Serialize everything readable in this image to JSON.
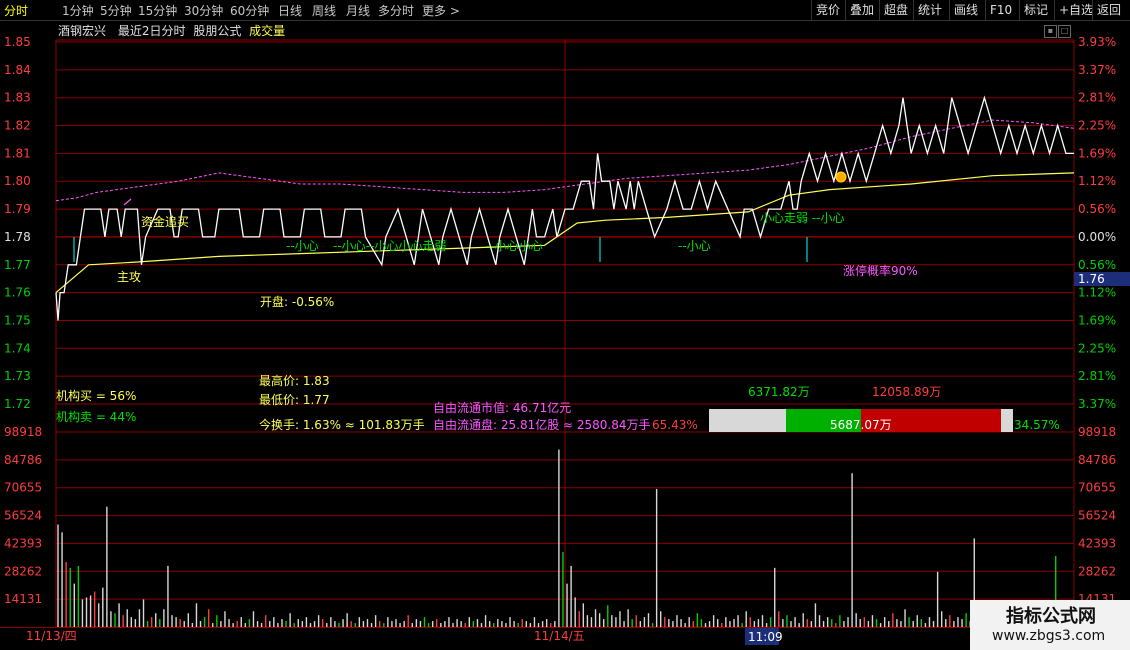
{
  "toolbar": {
    "periods": [
      "分时",
      "1分钟",
      "5分钟",
      "15分钟",
      "30分钟",
      "60分钟",
      "日线",
      "周线",
      "月线",
      "多分时",
      "更多 >"
    ],
    "active_index": 0,
    "right": [
      "竞价",
      "叠加",
      "超盘",
      "统计",
      "画线",
      "F10",
      "标记",
      "+自选",
      "返回"
    ]
  },
  "header": {
    "stock": "酒钢宏兴",
    "mode": "最近2日分时",
    "formula": "股朋公式",
    "indicator": "成交量"
  },
  "colors": {
    "up": "#ff3c3c",
    "down": "#00d000",
    "price": "#ffffff",
    "avg": "#ffff55",
    "mag": "#ff55ff",
    "cyan": "#00ffff",
    "grid": "#8b0000"
  },
  "price_axis": {
    "left": [
      "1.85",
      "1.84",
      "1.83",
      "1.82",
      "1.81",
      "1.80",
      "1.79",
      "1.78",
      "1.77",
      "1.76",
      "1.75",
      "1.74",
      "1.73",
      "1.72"
    ],
    "right": [
      "3.93%",
      "3.37%",
      "2.81%",
      "2.25%",
      "1.69%",
      "1.12%",
      "0.56%",
      "0.00%",
      "0.56%",
      "1.12%",
      "1.69%",
      "2.25%",
      "2.81%",
      "3.37%"
    ],
    "current_tag": "1.76"
  },
  "volume_axis": [
    "98918",
    "84786",
    "70655",
    "56524",
    "42393",
    "28262",
    "14131"
  ],
  "time_axis": {
    "labels": [
      "11/13/四",
      "11/14/五"
    ],
    "cursor": "11:09"
  },
  "annotations": {
    "zhugong": "主攻",
    "zijin": "资金追买",
    "xiaoxin": [
      "--小心",
      "--小心--小心小心走弱",
      "--小心小心",
      "--小心",
      "小心走弱 --小心"
    ],
    "zhangting": "涨停概率90%"
  },
  "info": {
    "open": "开盘: -0.56%",
    "inst_buy": "机构买 = 56%",
    "inst_sell": "机构卖 = 44%",
    "high": "最高价: 1.83",
    "low": "最低价: 1.77",
    "turnover": "今换手: 1.63% ≈ 101.83万手",
    "free_mv": "自由流通市值: 46.71亿元",
    "free_float": "自由流通盘: 25.81亿股 ≈ 2580.84万手",
    "free_pct": "65.43%",
    "flow_green": "6371.82万",
    "flow_red": "12058.89万",
    "flow_mid": "5687.07万",
    "flow_pct": "34.57%"
  },
  "watermark": {
    "title": "指标公式网",
    "url": "www.zbgs3.com"
  },
  "chart_data": {
    "type": "line",
    "y_range": [
      1.72,
      1.85
    ],
    "prev_close": 1.78,
    "volume_range": [
      0,
      98918
    ],
    "price_path": [
      [
        0,
        1.76
      ],
      [
        1,
        1.75
      ],
      [
        2,
        1.76
      ],
      [
        4,
        1.76
      ],
      [
        6,
        1.77
      ],
      [
        10,
        1.77
      ],
      [
        12,
        1.78
      ],
      [
        14,
        1.79
      ],
      [
        22,
        1.79
      ],
      [
        24,
        1.78
      ],
      [
        26,
        1.79
      ],
      [
        30,
        1.79
      ],
      [
        32,
        1.78
      ],
      [
        34,
        1.79
      ],
      [
        40,
        1.79
      ],
      [
        42,
        1.77
      ],
      [
        44,
        1.78
      ],
      [
        50,
        1.79
      ],
      [
        56,
        1.79
      ],
      [
        58,
        1.78
      ],
      [
        60,
        1.78
      ],
      [
        62,
        1.79
      ],
      [
        70,
        1.79
      ],
      [
        72,
        1.78
      ],
      [
        78,
        1.78
      ],
      [
        80,
        1.79
      ],
      [
        90,
        1.79
      ],
      [
        92,
        1.78
      ],
      [
        100,
        1.78
      ],
      [
        102,
        1.79
      ],
      [
        110,
        1.79
      ],
      [
        112,
        1.78
      ],
      [
        120,
        1.78
      ],
      [
        122,
        1.79
      ],
      [
        130,
        1.79
      ],
      [
        132,
        1.78
      ],
      [
        140,
        1.78
      ],
      [
        142,
        1.79
      ],
      [
        150,
        1.79
      ],
      [
        152,
        1.78
      ],
      [
        160,
        1.77
      ],
      [
        162,
        1.78
      ],
      [
        168,
        1.79
      ],
      [
        172,
        1.78
      ],
      [
        176,
        1.77
      ],
      [
        178,
        1.78
      ],
      [
        180,
        1.79
      ],
      [
        184,
        1.78
      ],
      [
        188,
        1.77
      ],
      [
        190,
        1.78
      ],
      [
        194,
        1.79
      ],
      [
        198,
        1.78
      ],
      [
        202,
        1.77
      ],
      [
        204,
        1.78
      ],
      [
        208,
        1.79
      ],
      [
        212,
        1.78
      ],
      [
        216,
        1.77
      ],
      [
        218,
        1.78
      ],
      [
        222,
        1.79
      ],
      [
        226,
        1.78
      ],
      [
        230,
        1.77
      ],
      [
        232,
        1.78
      ],
      [
        234,
        1.79
      ],
      [
        236,
        1.78
      ],
      [
        240,
        1.78
      ],
      [
        244,
        1.79
      ],
      [
        246,
        1.78
      ],
      [
        250,
        1.79
      ],
      [
        254,
        1.79
      ],
      [
        258,
        1.8
      ],
      [
        262,
        1.8
      ],
      [
        264,
        1.79
      ],
      [
        266,
        1.81
      ],
      [
        268,
        1.8
      ],
      [
        272,
        1.8
      ],
      [
        274,
        1.79
      ],
      [
        276,
        1.8
      ],
      [
        280,
        1.79
      ],
      [
        282,
        1.8
      ],
      [
        284,
        1.79
      ],
      [
        286,
        1.8
      ],
      [
        290,
        1.79
      ],
      [
        294,
        1.78
      ],
      [
        300,
        1.79
      ],
      [
        304,
        1.8
      ],
      [
        308,
        1.79
      ],
      [
        312,
        1.79
      ],
      [
        316,
        1.8
      ],
      [
        320,
        1.79
      ],
      [
        324,
        1.8
      ],
      [
        330,
        1.79
      ],
      [
        336,
        1.78
      ],
      [
        338,
        1.79
      ],
      [
        342,
        1.79
      ],
      [
        346,
        1.78
      ],
      [
        350,
        1.79
      ],
      [
        356,
        1.79
      ],
      [
        360,
        1.8
      ],
      [
        362,
        1.79
      ],
      [
        364,
        1.79
      ],
      [
        366,
        1.8
      ],
      [
        370,
        1.81
      ],
      [
        374,
        1.8
      ],
      [
        378,
        1.81
      ],
      [
        382,
        1.8
      ],
      [
        386,
        1.81
      ],
      [
        390,
        1.8
      ],
      [
        394,
        1.81
      ],
      [
        398,
        1.8
      ],
      [
        402,
        1.81
      ],
      [
        406,
        1.82
      ],
      [
        410,
        1.81
      ],
      [
        414,
        1.82
      ],
      [
        416,
        1.83
      ],
      [
        418,
        1.82
      ],
      [
        420,
        1.81
      ],
      [
        424,
        1.82
      ],
      [
        428,
        1.81
      ],
      [
        432,
        1.82
      ],
      [
        436,
        1.81
      ],
      [
        440,
        1.83
      ],
      [
        444,
        1.82
      ],
      [
        448,
        1.81
      ],
      [
        452,
        1.82
      ],
      [
        456,
        1.83
      ],
      [
        460,
        1.82
      ],
      [
        464,
        1.81
      ],
      [
        468,
        1.82
      ],
      [
        472,
        1.81
      ],
      [
        476,
        1.82
      ],
      [
        480,
        1.81
      ],
      [
        484,
        1.82
      ],
      [
        488,
        1.81
      ],
      [
        492,
        1.82
      ],
      [
        496,
        1.81
      ],
      [
        500,
        1.81
      ]
    ],
    "avg_path": [
      [
        0,
        1.76
      ],
      [
        8,
        1.765
      ],
      [
        16,
        1.77
      ],
      [
        40,
        1.771
      ],
      [
        80,
        1.773
      ],
      [
        120,
        1.774
      ],
      [
        160,
        1.775
      ],
      [
        200,
        1.776
      ],
      [
        240,
        1.777
      ],
      [
        256,
        1.785
      ],
      [
        270,
        1.786
      ],
      [
        300,
        1.787
      ],
      [
        340,
        1.789
      ],
      [
        360,
        1.795
      ],
      [
        380,
        1.797
      ],
      [
        420,
        1.799
      ],
      [
        460,
        1.802
      ],
      [
        500,
        1.803
      ]
    ],
    "mag_path": [
      [
        0,
        1.793
      ],
      [
        10,
        1.794
      ],
      [
        20,
        1.796
      ],
      [
        40,
        1.798
      ],
      [
        60,
        1.8
      ],
      [
        80,
        1.803
      ],
      [
        100,
        1.801
      ],
      [
        120,
        1.799
      ],
      [
        140,
        1.799
      ],
      [
        160,
        1.798
      ],
      [
        180,
        1.797
      ],
      [
        200,
        1.796
      ],
      [
        220,
        1.796
      ],
      [
        240,
        1.797
      ],
      [
        260,
        1.799
      ],
      [
        280,
        1.801
      ],
      [
        300,
        1.802
      ],
      [
        320,
        1.803
      ],
      [
        340,
        1.804
      ],
      [
        360,
        1.806
      ],
      [
        380,
        1.809
      ],
      [
        400,
        1.812
      ],
      [
        420,
        1.816
      ],
      [
        440,
        1.819
      ],
      [
        460,
        1.822
      ],
      [
        480,
        1.821
      ],
      [
        500,
        1.819
      ]
    ],
    "volume": [
      52000,
      48000,
      33000,
      30000,
      22000,
      31000,
      14000,
      15000,
      16000,
      18000,
      12000,
      20000,
      61000,
      8000,
      7000,
      12000,
      6000,
      9000,
      5000,
      4000,
      9000,
      14000,
      3000,
      5000,
      7000,
      4000,
      9000,
      31000,
      6000,
      5000,
      4000,
      3000,
      7000,
      2000,
      12000,
      3000,
      5000,
      9000,
      2000,
      6000,
      3000,
      8000,
      4000,
      2000,
      3000,
      5000,
      2000,
      4000,
      8000,
      3000,
      2000,
      6000,
      3000,
      5000,
      2000,
      4000,
      3000,
      7000,
      2000,
      4000,
      3000,
      5000,
      2000,
      3000,
      6000,
      4000,
      2000,
      5000,
      3000,
      2000,
      4000,
      7000,
      3000,
      2000,
      5000,
      3000,
      4000,
      2000,
      6000,
      3000,
      2000,
      5000,
      3000,
      4000,
      2000,
      3000,
      6000,
      2000,
      4000,
      3000,
      5000,
      2000,
      3000,
      4000,
      2000,
      3000,
      5000,
      2000,
      4000,
      3000,
      2000,
      5000,
      3000,
      4000,
      2000,
      6000,
      3000,
      2000,
      4000,
      3000,
      2000,
      5000,
      3000,
      2000,
      4000,
      3000,
      2000,
      5000,
      2000,
      3000,
      4000,
      2000,
      3000,
      90000,
      38000,
      22000,
      31000,
      15000,
      8000,
      12000,
      6000,
      5000,
      9000,
      7000,
      4000,
      11000,
      6000,
      5000,
      8000,
      3000,
      9000,
      4000,
      6000,
      3000,
      5000,
      7000,
      2000,
      70000,
      8000,
      5000,
      4000,
      3000,
      6000,
      4000,
      2000,
      5000,
      3000,
      7000,
      4000,
      2000,
      3000,
      6000,
      4000,
      2000,
      5000,
      3000,
      4000,
      6000,
      2000,
      8000,
      5000,
      3000,
      4000,
      6000,
      2000,
      5000,
      30000,
      8000,
      4000,
      6000,
      3000,
      5000,
      2000,
      7000,
      4000,
      3000,
      12000,
      6000,
      3000,
      5000,
      4000,
      2000,
      6000,
      3000,
      5000,
      78000,
      7000,
      4000,
      5000,
      3000,
      6000,
      4000,
      2000,
      5000,
      3000,
      7000,
      4000,
      3000,
      9000,
      5000,
      3000,
      6000,
      4000,
      2000,
      5000,
      3000,
      28000,
      8000,
      4000,
      6000,
      3000,
      5000,
      4000,
      7000,
      3000,
      45000,
      8000,
      5000,
      4000,
      3000,
      6000,
      4000,
      5000,
      3000,
      7000,
      4000,
      3000,
      6000,
      5000,
      4000,
      3000,
      6000,
      4000,
      5000,
      3000,
      36000,
      10000,
      6000,
      4000
    ],
    "volume_colors": "r"
  }
}
